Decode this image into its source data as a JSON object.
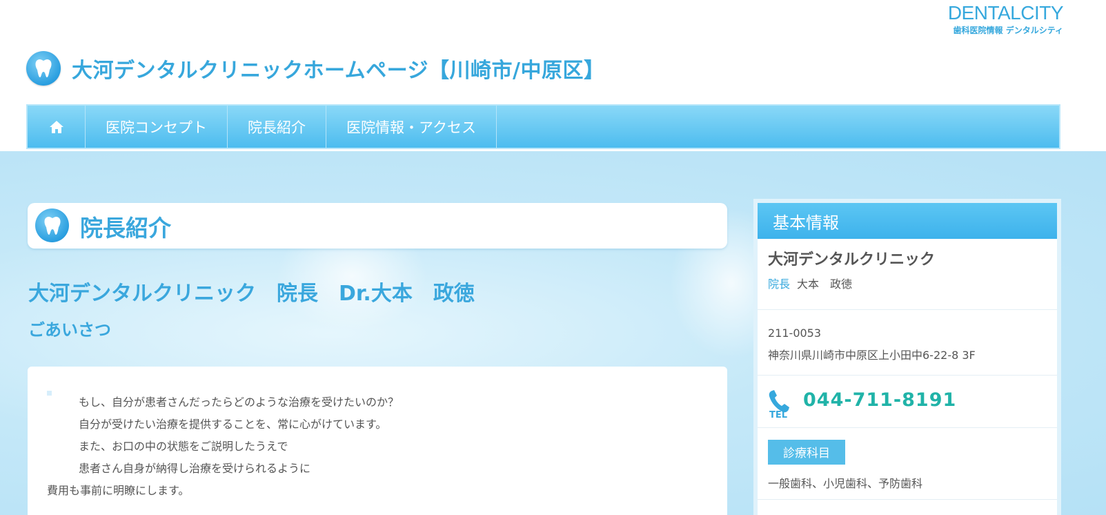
{
  "brand": {
    "name": "DENTALCITY",
    "subtitle": "歯科医院情報 デンタルシティ"
  },
  "site": {
    "title": "大河デンタルクリニックホームページ【川崎市/中原区】"
  },
  "nav": {
    "items": [
      {
        "label": "医院コンセプト"
      },
      {
        "label": "院長紹介"
      },
      {
        "label": "医院情報・アクセス"
      }
    ]
  },
  "main": {
    "page_heading": "院長紹介",
    "doctor_title": "大河デンタルクリニック　院長　Dr.大本　政徳",
    "greeting_title": "ごあいさつ",
    "message_lines": [
      "もし、自分が患者さんだったらどのような治療を受けたいのか？",
      "自分が受けたい治療を提供することを、常に心がけています。",
      "また、お口の中の状態をご説明したうえで",
      "患者さん自身が納得し治療を受けられるように",
      "費用も事前に明瞭にします。"
    ]
  },
  "sidebar": {
    "header": "基本情報",
    "clinic_name": "大河デンタルクリニック",
    "director_role": "院長",
    "director_name": "大本　政徳",
    "postal_code": "211-0053",
    "address": "神奈川県川崎市中原区上小田中6-22-8 3F",
    "tel_label": "TEL",
    "tel_number": "044-711-8191",
    "dept_label": "診療科目",
    "dept_list": "一般歯科、小児歯科、予防歯科"
  },
  "colors": {
    "accent": "#37a7dc",
    "nav": "#4cbcef",
    "tel": "#20b3a8"
  },
  "icons": [
    "tooth-icon",
    "home-icon",
    "phone-icon"
  ]
}
